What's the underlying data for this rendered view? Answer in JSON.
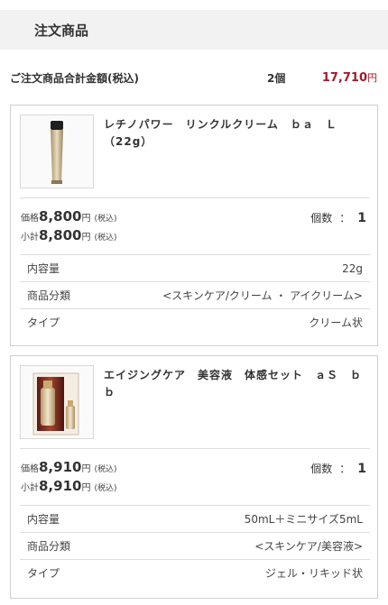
{
  "header": {
    "title": "注文商品"
  },
  "summary": {
    "label": "ご注文商品合計金額(税込)",
    "count": "2個",
    "total_amount": "17,710",
    "total_unit": "円"
  },
  "labels": {
    "price": "価格",
    "subtotal": "小計",
    "yen": "円",
    "tax": "(税込)",
    "qty": "個数",
    "qty_sep": "："
  },
  "items": [
    {
      "name": "レチノパワー　リンクルクリーム　ｂａ　Ｌ　（22g）",
      "price": "8,800",
      "subtotal": "8,800",
      "qty": "1",
      "specs": [
        {
          "label": "内容量",
          "value": "22g"
        },
        {
          "label": "商品分類",
          "value": "<スキンケア/クリーム ・ アイクリーム>"
        },
        {
          "label": "タイプ",
          "value": "クリーム状"
        }
      ]
    },
    {
      "name": "エイジングケア　美容液　体感セット　ａＳ　ｂｂ",
      "price": "8,910",
      "subtotal": "8,910",
      "qty": "1",
      "specs": [
        {
          "label": "内容量",
          "value": "50mL＋ミニサイズ5mL"
        },
        {
          "label": "商品分類",
          "value": "<スキンケア/美容液>"
        },
        {
          "label": "タイプ",
          "value": "ジェル・リキッド状"
        }
      ]
    }
  ]
}
